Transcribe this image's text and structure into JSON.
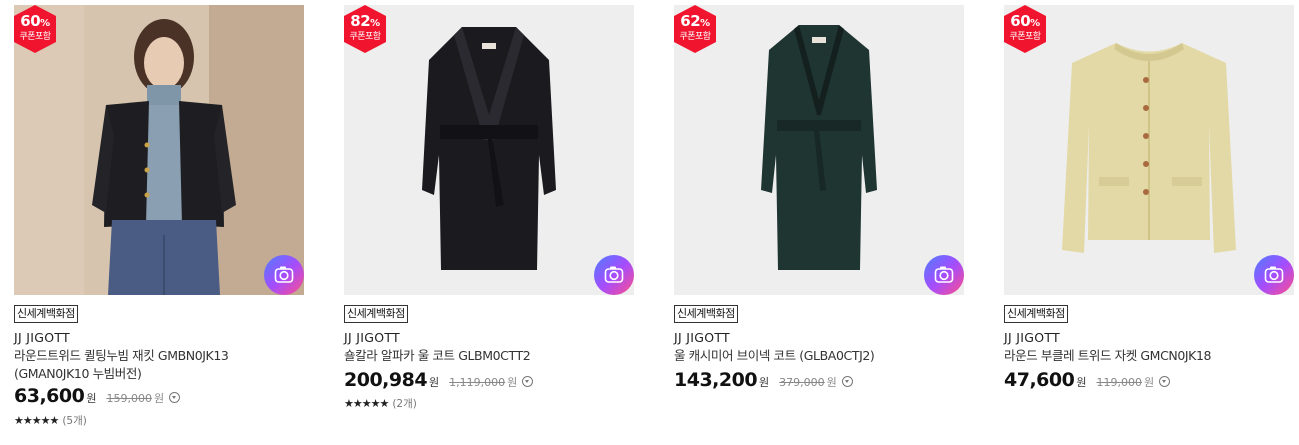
{
  "products": [
    {
      "discount": "60",
      "discount_unit": "%",
      "coupon_label": "쿠폰포함",
      "store": "신세계백화점",
      "brand": "JJ JIGOTT",
      "name": "라운드트위드 퀼팅누빔 재킷 GMBN0JK13 (GMAN0JK10 누빔버전)",
      "price": "63,600",
      "price_unit": "원",
      "original_price": "159,000",
      "original_unit": "원",
      "stars": "★★★★★",
      "review_count": "(5개)",
      "image_desc": "model-in-black-tweed-jacket"
    },
    {
      "discount": "82",
      "discount_unit": "%",
      "coupon_label": "쿠폰포함",
      "store": "신세계백화점",
      "brand": "JJ JIGOTT",
      "name": "숄칼라 알파카 울 코트 GLBM0CTT2",
      "price": "200,984",
      "price_unit": "원",
      "original_price": "1,119,000",
      "original_unit": "원",
      "stars": "★★★★★",
      "review_count": "(2개)",
      "image_desc": "black-shawl-collar-coat"
    },
    {
      "discount": "62",
      "discount_unit": "%",
      "coupon_label": "쿠폰포함",
      "store": "신세계백화점",
      "brand": "JJ JIGOTT",
      "name": "울 캐시미어 브이넥 코트 (GLBA0CTJ2)",
      "price": "143,200",
      "price_unit": "원",
      "original_price": "379,000",
      "original_unit": "원",
      "image_desc": "dark-green-vneck-coat"
    },
    {
      "discount": "60",
      "discount_unit": "%",
      "coupon_label": "쿠폰포함",
      "store": "신세계백화점",
      "brand": "JJ JIGOTT",
      "name": "라운드 부클레 트위드 자켓 GMCN0JK18",
      "price": "47,600",
      "price_unit": "원",
      "original_price": "119,000",
      "original_unit": "원",
      "image_desc": "beige-boucle-tweed-jacket"
    }
  ],
  "colors": {
    "badge_red": "#f0142f",
    "coat_black": "#1a1a1f",
    "coat_green": "#1f3532",
    "jacket_beige": "#e3d9a6"
  },
  "icons": {
    "badge": "hexagon-discount-badge",
    "camera": "camera-search-icon",
    "info": "chevron-circle-info-icon"
  }
}
